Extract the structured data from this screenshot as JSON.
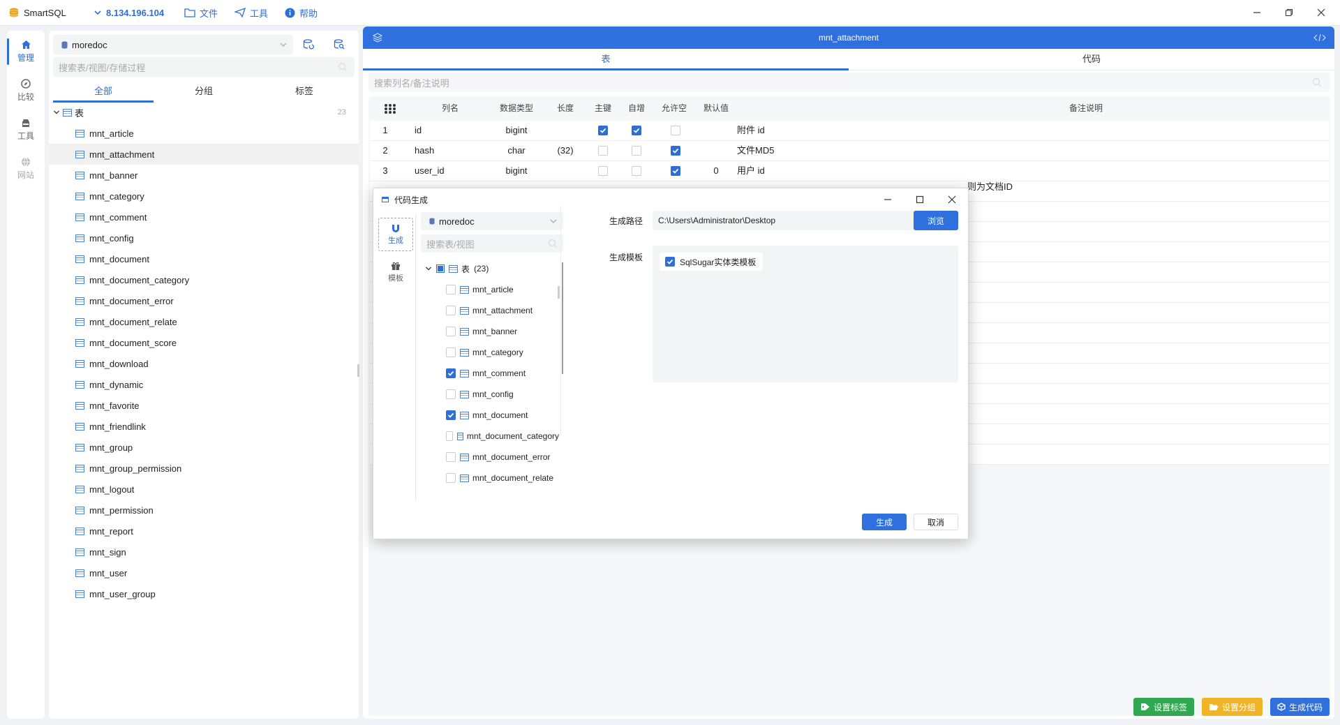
{
  "app": {
    "name": "SmartSQL",
    "connection": "8.134.196.104",
    "menu": {
      "file": "文件",
      "tools": "工具",
      "help": "帮助"
    }
  },
  "leftnav": [
    {
      "label": "管理",
      "icon": "home-icon",
      "active": true
    },
    {
      "label": "比较",
      "icon": "compass-icon",
      "active": false
    },
    {
      "label": "工具",
      "icon": "toolbox-icon",
      "active": false
    },
    {
      "label": "网站",
      "icon": "globe-icon",
      "active": false
    }
  ],
  "explorer": {
    "database": "moredoc",
    "search_placeholder": "搜索表/视图/存储过程",
    "tabs": [
      "全部",
      "分组",
      "标签"
    ],
    "root_label": "表",
    "root_count": "23",
    "tables": [
      "mnt_article",
      "mnt_attachment",
      "mnt_banner",
      "mnt_category",
      "mnt_comment",
      "mnt_config",
      "mnt_document",
      "mnt_document_category",
      "mnt_document_error",
      "mnt_document_relate",
      "mnt_document_score",
      "mnt_download",
      "mnt_dynamic",
      "mnt_favorite",
      "mnt_friendlink",
      "mnt_group",
      "mnt_group_permission",
      "mnt_logout",
      "mnt_permission",
      "mnt_report",
      "mnt_sign",
      "mnt_user",
      "mnt_user_group"
    ],
    "selected": "mnt_attachment"
  },
  "main": {
    "title": "mnt_attachment",
    "tabs": [
      "表",
      "代码"
    ],
    "search_placeholder": "搜索列名/备注说明",
    "columns": [
      "列名",
      "数据类型",
      "长度",
      "主键",
      "自增",
      "允许空",
      "默认值",
      "备注说明"
    ],
    "rows": [
      {
        "no": "1",
        "name": "id",
        "type": "bigint",
        "length": "",
        "pk": true,
        "auto": true,
        "nullable": false,
        "default": "",
        "comment": "附件 id"
      },
      {
        "no": "2",
        "name": "hash",
        "type": "char",
        "length": "(32)",
        "pk": false,
        "auto": false,
        "nullable": true,
        "default": "",
        "comment": "文件MD5"
      },
      {
        "no": "3",
        "name": "user_id",
        "type": "bigint",
        "length": "",
        "pk": false,
        "auto": false,
        "nullable": true,
        "default": "0",
        "comment": "用户 id"
      }
    ],
    "partial_comment": "则为文档ID"
  },
  "bottom_buttons": [
    {
      "label": "设置标签",
      "color": "#2fa84f",
      "icon": "tag-icon"
    },
    {
      "label": "设置分组",
      "color": "#f0b429",
      "icon": "folder-icon"
    },
    {
      "label": "生成代码",
      "color": "#2f6fde",
      "icon": "cube-icon"
    }
  ],
  "dialog": {
    "title": "代码生成",
    "nav": [
      {
        "label": "生成",
        "icon": "magnet-icon",
        "active": true
      },
      {
        "label": "模板",
        "icon": "gift-icon",
        "active": false
      }
    ],
    "database": "moredoc",
    "search_placeholder": "搜索表/视图",
    "root_label": "表",
    "root_count": "(23)",
    "tables": [
      {
        "name": "mnt_article",
        "checked": false
      },
      {
        "name": "mnt_attachment",
        "checked": false
      },
      {
        "name": "mnt_banner",
        "checked": false
      },
      {
        "name": "mnt_category",
        "checked": false
      },
      {
        "name": "mnt_comment",
        "checked": true
      },
      {
        "name": "mnt_config",
        "checked": false
      },
      {
        "name": "mnt_document",
        "checked": true
      },
      {
        "name": "mnt_document_category",
        "checked": false
      },
      {
        "name": "mnt_document_error",
        "checked": false
      },
      {
        "name": "mnt_document_relate",
        "checked": false
      }
    ],
    "path_label": "生成路径",
    "path_value": "C:\\Users\\Administrator\\Desktop",
    "browse_label": "浏览",
    "template_label": "生成模板",
    "template_option": "SqlSugar实体类模板",
    "generate_label": "生成",
    "cancel_label": "取消"
  }
}
